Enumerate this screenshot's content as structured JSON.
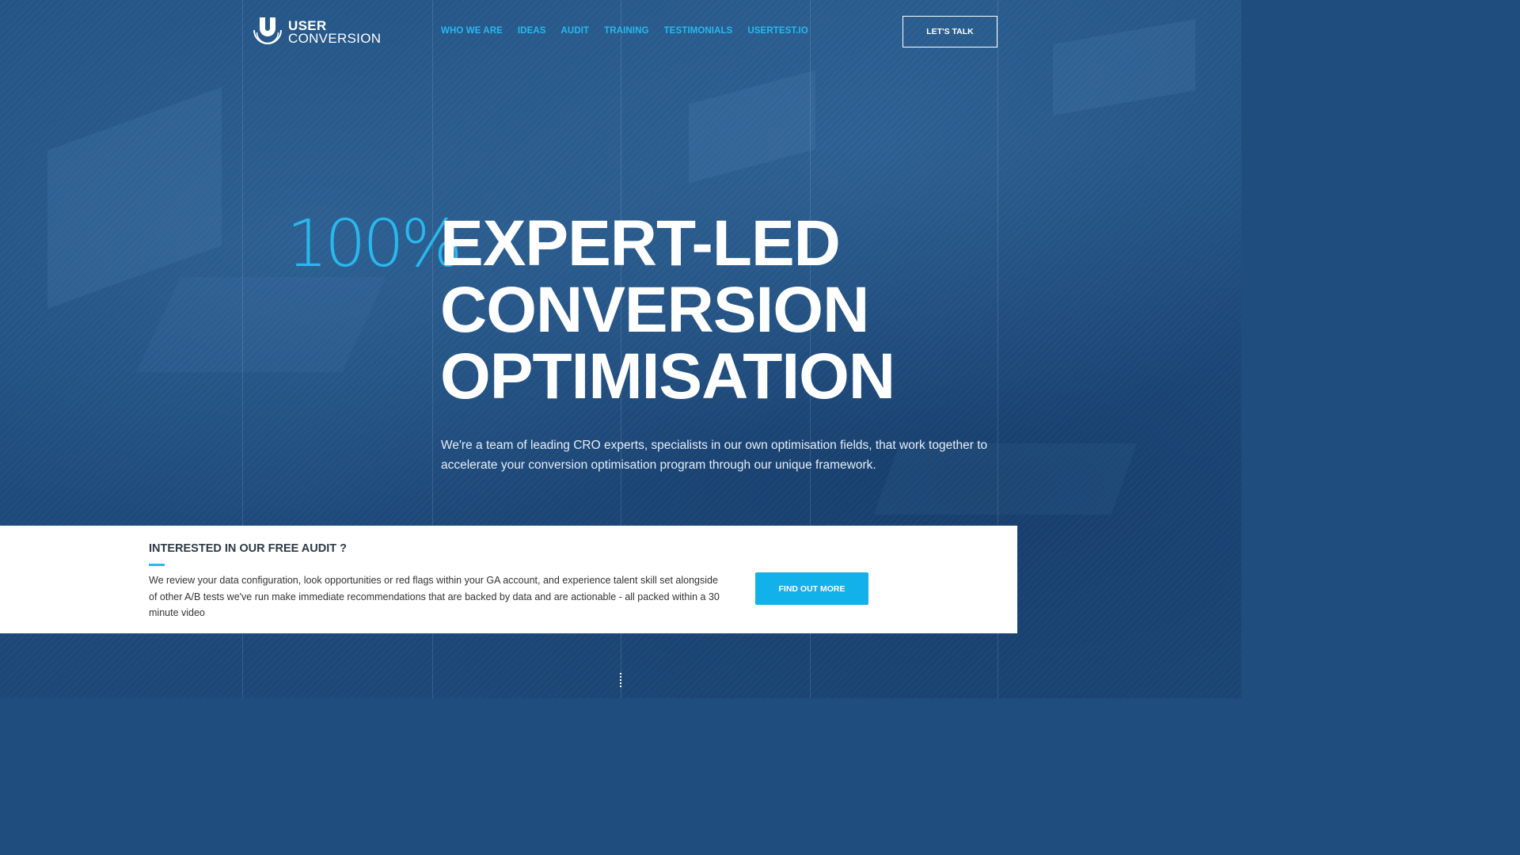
{
  "brand": {
    "name_line1": "USER",
    "name_line2": "CONVERSION",
    "accent_color": "#29b8ee",
    "background_color": "#1f4d7e"
  },
  "nav": {
    "items": [
      {
        "label": "WHO WE ARE"
      },
      {
        "label": "IDEAS"
      },
      {
        "label": "AUDIT"
      },
      {
        "label": "TRAINING"
      },
      {
        "label": "TESTIMONIALS"
      },
      {
        "label": "USERTEST.IO"
      }
    ],
    "cta_label": "LET'S TALK"
  },
  "hero": {
    "percent": "100%",
    "headline_lines": [
      "EXPERT-LED",
      "CONVERSION",
      "OPTIMISATION"
    ],
    "description": "We're a team of leading CRO experts, specialists in our own optimisation fields, that work together to accelerate your conversion optimisation program through our unique framework."
  },
  "audit": {
    "title": "INTERESTED IN OUR FREE AUDIT ?",
    "text": "We review your data configuration, look opportunities or red flags within your GA account, and experience talent skill set alongside of other A/B tests we've run make immediate recommendations that are backed by data and are actionable - all packed within a 30 minute video",
    "button_label": "FIND OUT MORE"
  },
  "icons": {
    "logo": "user-conversion-u-logo",
    "scroll": "scroll-down-dots-icon"
  }
}
